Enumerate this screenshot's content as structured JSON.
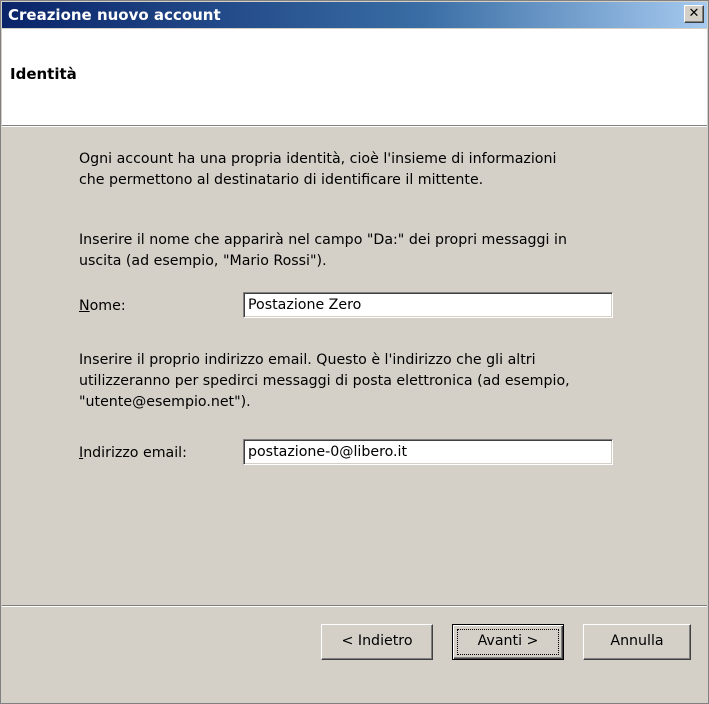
{
  "window": {
    "title": "Creazione nuovo account",
    "close_label": "✕"
  },
  "header": {
    "title": "Identità"
  },
  "intro": {
    "line1": "Ogni account ha una propria identità, cioè l'insieme di informazioni",
    "line2": "che permettono al destinatario di identificare il mittente."
  },
  "name_section": {
    "line1": "Inserire il nome che apparirà nel campo \"Da:\" dei propri messaggi in",
    "line2": "uscita (ad esempio, \"Mario Rossi\").",
    "label_accesskey": "N",
    "label_rest": "ome:",
    "value": "Postazione Zero"
  },
  "email_section": {
    "line1": "Inserire il proprio indirizzo email. Questo è l'indirizzo che gli altri",
    "line2": "utilizzeranno per spedirci messaggi di posta elettronica (ad esempio,",
    "line3": "\"utente@esempio.net\").",
    "label_accesskey": "I",
    "label_rest": "ndirizzo email:",
    "value": "postazione-0@libero.it"
  },
  "buttons": {
    "back": "< Indietro",
    "next": "Avanti >",
    "cancel": "Annulla"
  }
}
